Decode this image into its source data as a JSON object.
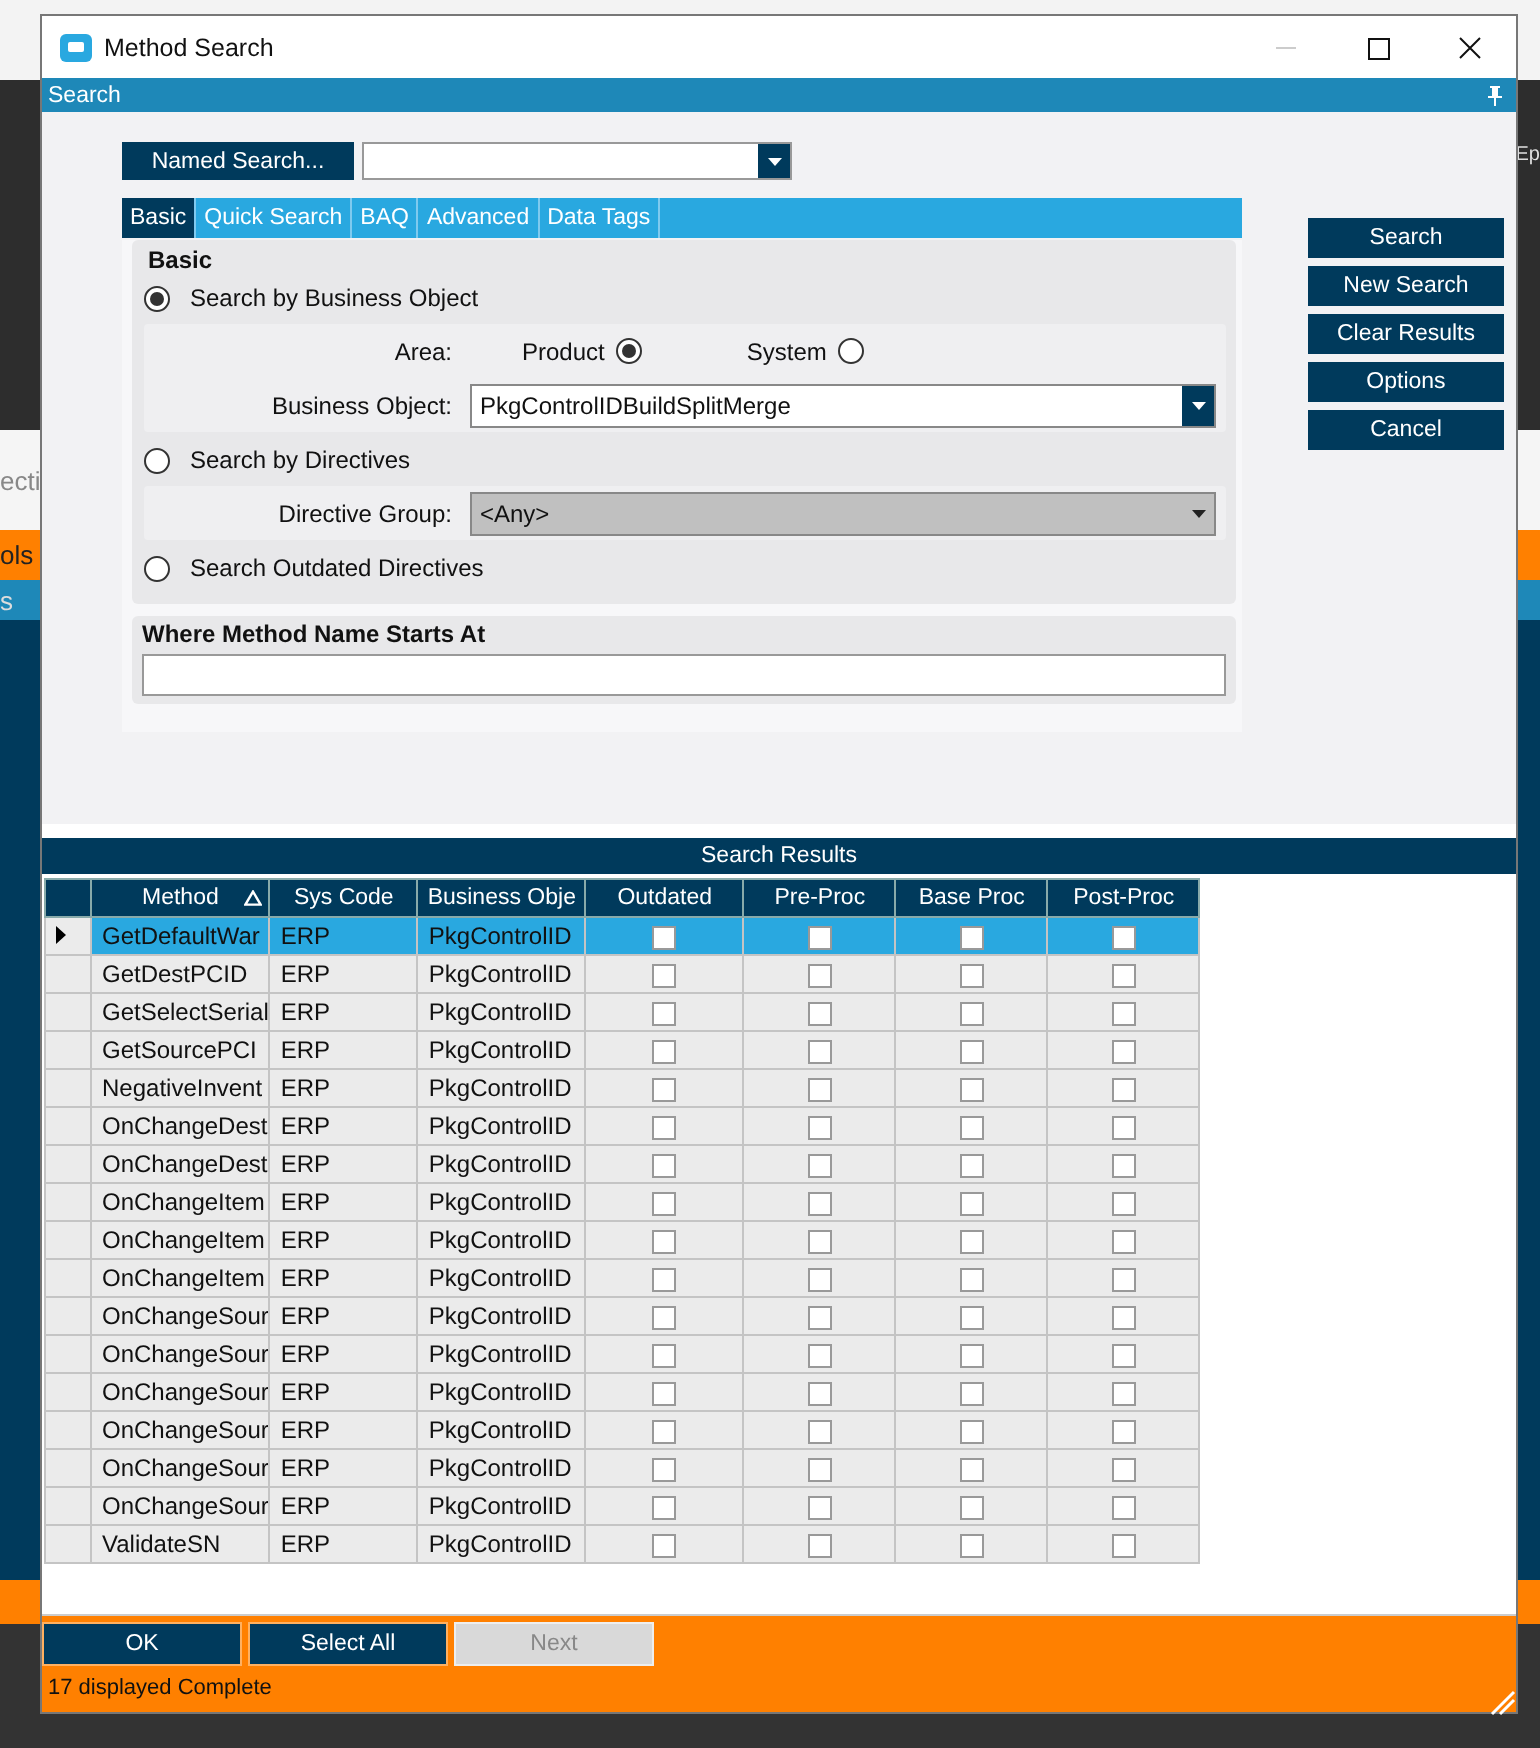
{
  "background_app": {
    "texts": [
      "Ep",
      "ecti",
      "ols",
      "s"
    ]
  },
  "window": {
    "title": "Method Search"
  },
  "panel_header": {
    "title": "Search"
  },
  "named_search": {
    "button": "Named Search..."
  },
  "tabs": [
    {
      "label": "Basic",
      "selected": true
    },
    {
      "label": "Quick Search",
      "selected": false
    },
    {
      "label": "BAQ",
      "selected": false
    },
    {
      "label": "Advanced",
      "selected": false
    },
    {
      "label": "Data Tags",
      "selected": false
    }
  ],
  "basic": {
    "title": "Basic",
    "options": [
      {
        "label": "Search by Business Object",
        "selected": true
      },
      {
        "label": "Search by Directives",
        "selected": false
      },
      {
        "label": "Search Outdated Directives",
        "selected": false
      }
    ],
    "area": {
      "label": "Area:",
      "options": [
        {
          "label": "Product",
          "selected": true
        },
        {
          "label": "System",
          "selected": false
        }
      ]
    },
    "business_object": {
      "label": "Business Object:",
      "value": "PkgControlIDBuildSplitMerge",
      "disabled": false
    },
    "directive_group": {
      "label": "Directive Group:",
      "value": "<Any>",
      "disabled": true
    }
  },
  "method_name": {
    "label": "Where Method Name Starts At"
  },
  "actions": [
    "Search",
    "New Search",
    "Clear Results",
    "Options",
    "Cancel"
  ],
  "results": {
    "title": "Search Results",
    "columns": [
      {
        "label": "Method",
        "sorted": true
      },
      {
        "label": "Sys Code",
        "sorted": false
      },
      {
        "label": "Business Obje",
        "sorted": false
      },
      {
        "label": "Outdated",
        "sorted": false
      },
      {
        "label": "Pre-Proc",
        "sorted": false
      },
      {
        "label": "Base Proc",
        "sorted": false
      },
      {
        "label": "Post-Proc",
        "sorted": false
      }
    ],
    "rows": [
      {
        "method": "GetDefaultWar",
        "sys_code": "ERP",
        "business_object": "PkgControlID",
        "outdated": false,
        "pre_proc": false,
        "base_proc": false,
        "post_proc": false,
        "selected": true
      },
      {
        "method": "GetDestPCID",
        "sys_code": "ERP",
        "business_object": "PkgControlID",
        "outdated": false,
        "pre_proc": false,
        "base_proc": false,
        "post_proc": false,
        "selected": false
      },
      {
        "method": "GetSelectSerial",
        "sys_code": "ERP",
        "business_object": "PkgControlID",
        "outdated": false,
        "pre_proc": false,
        "base_proc": false,
        "post_proc": false,
        "selected": false
      },
      {
        "method": "GetSourcePCI",
        "sys_code": "ERP",
        "business_object": "PkgControlID",
        "outdated": false,
        "pre_proc": false,
        "base_proc": false,
        "post_proc": false,
        "selected": false
      },
      {
        "method": "NegativeInvent",
        "sys_code": "ERP",
        "business_object": "PkgControlID",
        "outdated": false,
        "pre_proc": false,
        "base_proc": false,
        "post_proc": false,
        "selected": false
      },
      {
        "method": "OnChangeDest",
        "sys_code": "ERP",
        "business_object": "PkgControlID",
        "outdated": false,
        "pre_proc": false,
        "base_proc": false,
        "post_proc": false,
        "selected": false
      },
      {
        "method": "OnChangeDest",
        "sys_code": "ERP",
        "business_object": "PkgControlID",
        "outdated": false,
        "pre_proc": false,
        "base_proc": false,
        "post_proc": false,
        "selected": false
      },
      {
        "method": "OnChangeItem",
        "sys_code": "ERP",
        "business_object": "PkgControlID",
        "outdated": false,
        "pre_proc": false,
        "base_proc": false,
        "post_proc": false,
        "selected": false
      },
      {
        "method": "OnChangeItem",
        "sys_code": "ERP",
        "business_object": "PkgControlID",
        "outdated": false,
        "pre_proc": false,
        "base_proc": false,
        "post_proc": false,
        "selected": false
      },
      {
        "method": "OnChangeItem",
        "sys_code": "ERP",
        "business_object": "PkgControlID",
        "outdated": false,
        "pre_proc": false,
        "base_proc": false,
        "post_proc": false,
        "selected": false
      },
      {
        "method": "OnChangeSour",
        "sys_code": "ERP",
        "business_object": "PkgControlID",
        "outdated": false,
        "pre_proc": false,
        "base_proc": false,
        "post_proc": false,
        "selected": false
      },
      {
        "method": "OnChangeSour",
        "sys_code": "ERP",
        "business_object": "PkgControlID",
        "outdated": false,
        "pre_proc": false,
        "base_proc": false,
        "post_proc": false,
        "selected": false
      },
      {
        "method": "OnChangeSour",
        "sys_code": "ERP",
        "business_object": "PkgControlID",
        "outdated": false,
        "pre_proc": false,
        "base_proc": false,
        "post_proc": false,
        "selected": false
      },
      {
        "method": "OnChangeSour",
        "sys_code": "ERP",
        "business_object": "PkgControlID",
        "outdated": false,
        "pre_proc": false,
        "base_proc": false,
        "post_proc": false,
        "selected": false
      },
      {
        "method": "OnChangeSour",
        "sys_code": "ERP",
        "business_object": "PkgControlID",
        "outdated": false,
        "pre_proc": false,
        "base_proc": false,
        "post_proc": false,
        "selected": false
      },
      {
        "method": "OnChangeSour",
        "sys_code": "ERP",
        "business_object": "PkgControlID",
        "outdated": false,
        "pre_proc": false,
        "base_proc": false,
        "post_proc": false,
        "selected": false
      },
      {
        "method": "ValidateSN",
        "sys_code": "ERP",
        "business_object": "PkgControlID",
        "outdated": false,
        "pre_proc": false,
        "base_proc": false,
        "post_proc": false,
        "selected": false
      }
    ]
  },
  "footer_buttons": [
    {
      "label": "OK",
      "disabled": false
    },
    {
      "label": "Select All",
      "disabled": false
    },
    {
      "label": "Next",
      "disabled": true
    }
  ],
  "status_bar": "17 displayed Complete"
}
